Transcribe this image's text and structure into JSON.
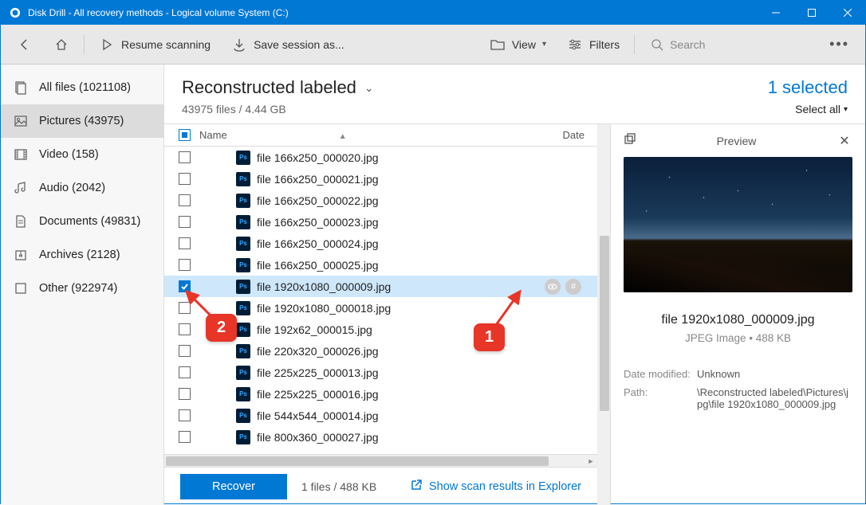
{
  "titlebar": {
    "title": "Disk Drill - All recovery methods - Logical volume System (C:)"
  },
  "toolbar": {
    "resume": "Resume scanning",
    "save": "Save session as...",
    "view": "View",
    "filters": "Filters",
    "search_placeholder": "Search"
  },
  "sidebar": {
    "items": [
      {
        "label": "All files (1021108)"
      },
      {
        "label": "Pictures (43975)"
      },
      {
        "label": "Video (158)"
      },
      {
        "label": "Audio (2042)"
      },
      {
        "label": "Documents (49831)"
      },
      {
        "label": "Archives (2128)"
      },
      {
        "label": "Other (922974)"
      }
    ]
  },
  "content": {
    "title": "Reconstructed labeled",
    "subtitle": "43975 files / 4.44 GB",
    "selected": "1 selected",
    "select_all": "Select all"
  },
  "columns": {
    "name": "Name",
    "date": "Date"
  },
  "files": [
    {
      "name": "file 166x250_000020.jpg",
      "checked": false
    },
    {
      "name": "file 166x250_000021.jpg",
      "checked": false
    },
    {
      "name": "file 166x250_000022.jpg",
      "checked": false
    },
    {
      "name": "file 166x250_000023.jpg",
      "checked": false
    },
    {
      "name": "file 166x250_000024.jpg",
      "checked": false
    },
    {
      "name": "file 166x250_000025.jpg",
      "checked": false
    },
    {
      "name": "file 1920x1080_000009.jpg",
      "checked": true,
      "selected": true
    },
    {
      "name": "file 1920x1080_000018.jpg",
      "checked": false
    },
    {
      "name": "file 192x62_000015.jpg",
      "checked": false
    },
    {
      "name": "file 220x320_000026.jpg",
      "checked": false
    },
    {
      "name": "file 225x225_000013.jpg",
      "checked": false
    },
    {
      "name": "file 225x225_000016.jpg",
      "checked": false
    },
    {
      "name": "file 544x544_000014.jpg",
      "checked": false
    },
    {
      "name": "file 800x360_000027.jpg",
      "checked": false
    }
  ],
  "preview": {
    "title": "Preview",
    "filename": "file 1920x1080_000009.jpg",
    "meta": "JPEG Image • 488 KB",
    "date_label": "Date modified:",
    "date_value": "Unknown",
    "path_label": "Path:",
    "path_value": "\\Reconstructed labeled\\Pictures\\jpg\\file 1920x1080_000009.jpg"
  },
  "footer": {
    "recover": "Recover",
    "info": "1 files / 488 KB",
    "link": "Show scan results in Explorer"
  },
  "callouts": {
    "one": "1",
    "two": "2"
  }
}
